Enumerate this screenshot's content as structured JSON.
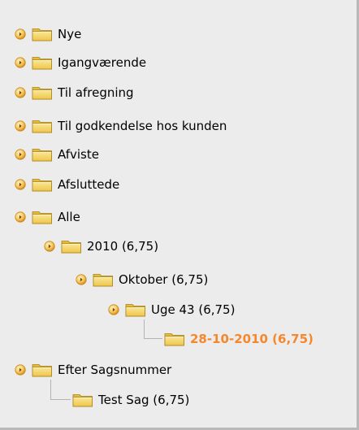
{
  "tree": {
    "nodes": [
      {
        "label": "Nye"
      },
      {
        "label": "Igangværende"
      },
      {
        "label": "Til afregning"
      },
      {
        "label": "Til godkendelse hos kunden"
      },
      {
        "label": "Afviste"
      },
      {
        "label": "Afsluttede"
      },
      {
        "label": "Alle"
      },
      {
        "label": "2010 (6,75)"
      },
      {
        "label": "Oktober (6,75)"
      },
      {
        "label": "Uge 43 (6,75)"
      },
      {
        "label": "28-10-2010 (6,75)"
      },
      {
        "label": "Efter Sagsnummer"
      },
      {
        "label": "Test Sag (6,75)"
      }
    ],
    "selected_color": "#f7872b",
    "folder_color": "#f2d46a",
    "toggle_icon": "expand-toggle-icon",
    "folder_icon": "folder-icon"
  }
}
